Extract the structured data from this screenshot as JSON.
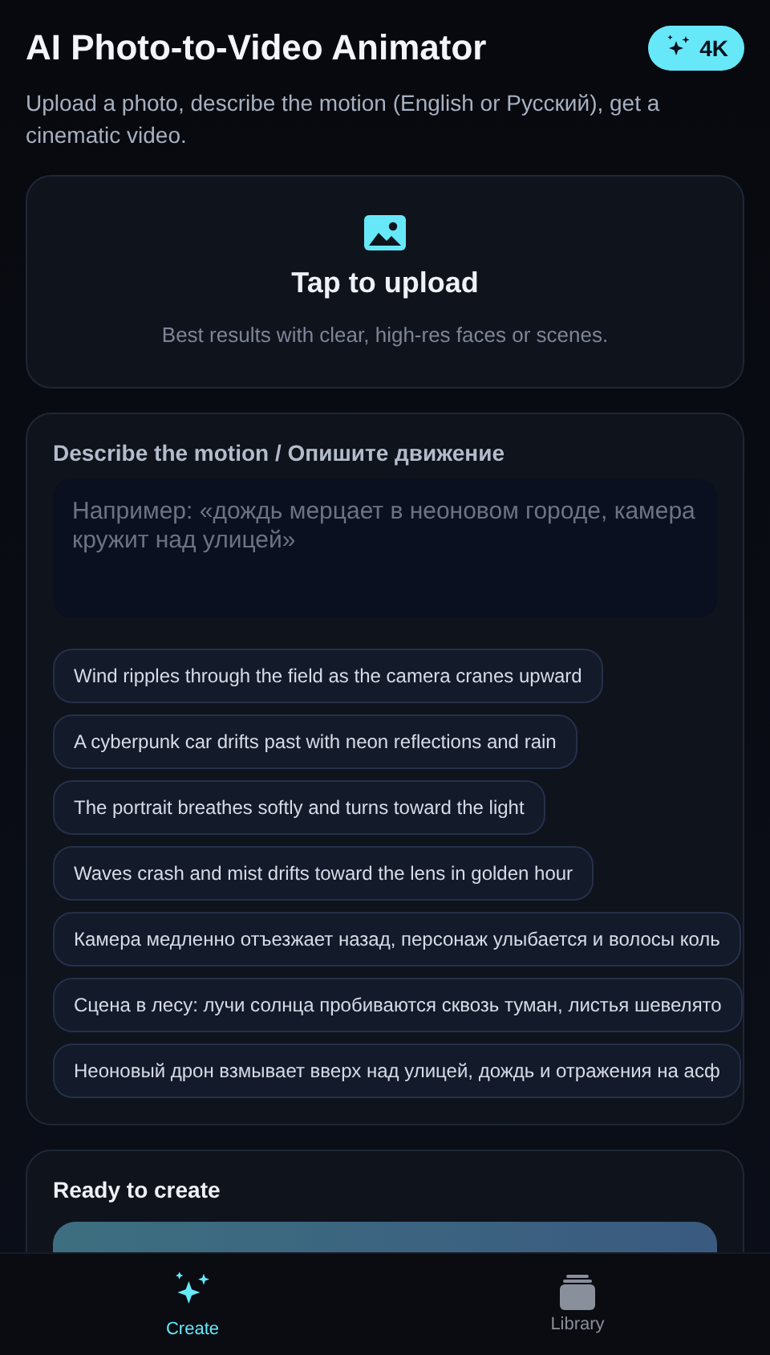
{
  "header": {
    "title": "AI Photo-to-Video Animator",
    "badge": "4K",
    "subtitle": "Upload a photo, describe the motion (English or Русский), get a cinematic video."
  },
  "upload": {
    "title": "Tap to upload",
    "hint": "Best results with clear, high-res faces or scenes."
  },
  "motion": {
    "label": "Describe the motion / Опишите движение",
    "placeholder": "Например: «дождь мерцает в неоновом городе, камера кружит над улицей»",
    "suggestions": [
      "Wind ripples through the field as the camera cranes upward",
      "A cyberpunk car drifts past with neon reflections and rain",
      "The portrait breathes softly and turns toward the light",
      "Waves crash and mist drifts toward the lens in golden hour",
      "Камера медленно отъезжает назад, персонаж улыбается и волосы коль",
      "Сцена в лесу: лучи солнца пробиваются сквозь туман, листья шевелято",
      "Неоновый дрон взмывает вверх над улицей, дождь и отражения на асф"
    ]
  },
  "create": {
    "title": "Ready to create"
  },
  "nav": [
    {
      "label": "Create",
      "selected": true
    },
    {
      "label": "Library",
      "selected": false
    }
  ]
}
